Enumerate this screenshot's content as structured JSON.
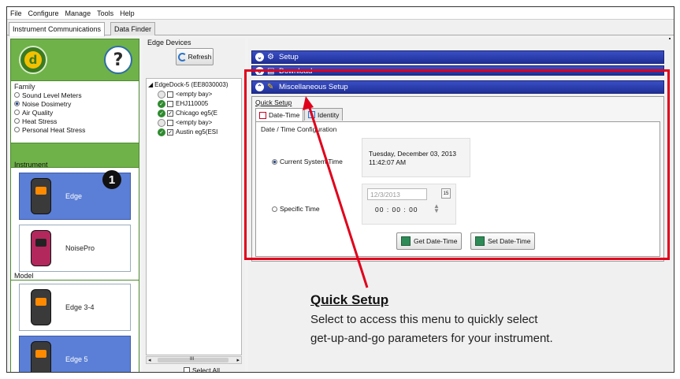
{
  "menu": [
    "File",
    "Configure",
    "Manage",
    "Tools",
    "Help"
  ],
  "tabs": [
    "Instrument Communications",
    "Data Finder"
  ],
  "left": {
    "family_title": "Family",
    "family_options": [
      {
        "label": "Sound Level Meters",
        "selected": false
      },
      {
        "label": "Noise Dosimetry",
        "selected": true
      },
      {
        "label": "Air Quality",
        "selected": false
      },
      {
        "label": "Heat Stress",
        "selected": false
      },
      {
        "label": "Personal Heat Stress",
        "selected": false
      }
    ],
    "instrument_title": "Instrument",
    "instruments": [
      {
        "name": "Edge",
        "selected": true
      },
      {
        "name": "NoisePro",
        "selected": false
      }
    ],
    "badge": "1",
    "model_title": "Model",
    "models": [
      {
        "name": "Edge 3-4",
        "selected": false
      },
      {
        "name": "Edge 5",
        "selected": true
      }
    ]
  },
  "edge": {
    "title": "Edge Devices",
    "refresh": "Refresh",
    "root": "EdgeDock-5 (EE8030003)",
    "items": [
      {
        "label": "<empty bay>",
        "status": "empty",
        "checked": false
      },
      {
        "label": "EHJ110005",
        "status": "ok",
        "checked": false
      },
      {
        "label": "Chicago eg5(E",
        "status": "ok",
        "checked": true
      },
      {
        "label": "<empty bay>",
        "status": "empty",
        "checked": false
      },
      {
        "label": "Austin eg5(ESI",
        "status": "ok",
        "checked": true
      }
    ],
    "scroll_glyph": "III",
    "select_all": "Select All"
  },
  "panels": {
    "setup": "Setup",
    "download": "Download",
    "misc": "Miscellaneous Setup",
    "quick_setup": "Quick Setup",
    "tab_datetime": "Date-Time",
    "tab_identity": "Identity",
    "config_title": "Date / Time Configuration",
    "current_label": "Current System Time",
    "current_value_line1": "Tuesday, December 03, 2013",
    "current_value_line2": "11:42:07 AM",
    "specific_label": "Specific Time",
    "date_value": "12/3/2013",
    "cal_glyph": "15",
    "time_value": "00 : 00 : 00",
    "get_btn": "Get Date-Time",
    "set_btn": "Set Date-Time"
  },
  "annotation": {
    "title": "Quick Setup",
    "line1": "Select to access this menu to quickly select",
    "line2": "get-up-and-go parameters for your instrument."
  },
  "colors": {
    "accent": "#2031a0",
    "highlight": "#e0001b",
    "sidebar": "#6fb249",
    "selection": "#5b7fd6"
  }
}
